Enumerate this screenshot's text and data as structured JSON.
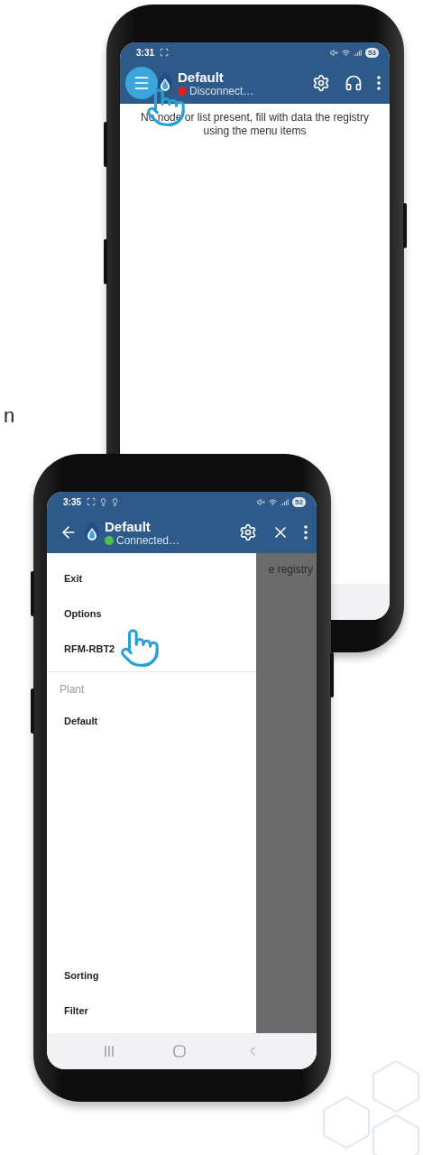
{
  "edge_text": "n",
  "phones": [
    {
      "status_bar": {
        "time": "3:31",
        "battery": "53"
      },
      "app_bar": {
        "leading": {
          "kind": "menu",
          "tapped": true
        },
        "title": "Default",
        "status": "Disconnect…",
        "connected": false,
        "actions": [
          {
            "kind": "gear"
          },
          {
            "kind": "headset"
          },
          {
            "kind": "more"
          }
        ]
      },
      "body": {
        "kind": "message",
        "message": "No node or list present, fill with data the registry using the menu items"
      }
    },
    {
      "status_bar": {
        "time": "3:35",
        "battery": "52"
      },
      "app_bar": {
        "leading": {
          "kind": "back",
          "tapped": false
        },
        "title": "Default",
        "status": "Connected…",
        "connected": true,
        "actions": [
          {
            "kind": "gear"
          },
          {
            "kind": "close"
          },
          {
            "kind": "more"
          }
        ]
      },
      "body": {
        "kind": "drawer",
        "behind_text": "e registry",
        "sections": [
          {
            "items": [
              {
                "label": "Exit",
                "tapped": false
              },
              {
                "label": "Options",
                "tapped": false
              },
              {
                "label": "RFM-RBT2",
                "tapped": true
              }
            ]
          },
          {
            "header": "Plant",
            "items": [
              {
                "label": "Default",
                "tapped": false
              }
            ]
          }
        ],
        "bottom_items": [
          {
            "label": "Sorting",
            "tapped": false
          },
          {
            "label": "Filter",
            "tapped": false
          }
        ]
      }
    }
  ]
}
